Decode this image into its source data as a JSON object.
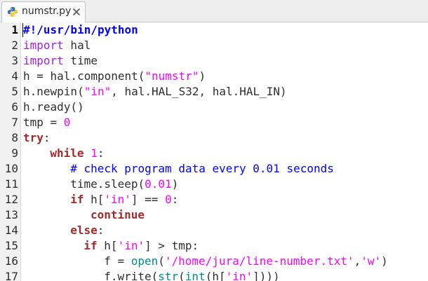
{
  "tab": {
    "filename": "numstr.py",
    "icon": "python-file-icon",
    "close_icon": "close-icon"
  },
  "colors": {
    "keyword": "#a52a2a",
    "import": "#a020f0",
    "string": "#ff00ff",
    "number": "#ff00ff",
    "comment": "#0000ff",
    "builtin": "#008b8b",
    "shebang": "#0000ff",
    "default": "#2e2e2e"
  },
  "editor": {
    "current_line": 1,
    "lines": [
      {
        "number": "1",
        "indent": 0,
        "tokens": [
          {
            "t": "shebang",
            "v": "#!/usr/bin/python"
          }
        ]
      },
      {
        "number": "2",
        "indent": 0,
        "tokens": [
          {
            "t": "import",
            "v": "import"
          },
          {
            "t": "default",
            "v": " hal"
          }
        ]
      },
      {
        "number": "3",
        "indent": 0,
        "tokens": [
          {
            "t": "import",
            "v": "import"
          },
          {
            "t": "default",
            "v": " time"
          }
        ]
      },
      {
        "number": "4",
        "indent": 0,
        "tokens": [
          {
            "t": "default",
            "v": "h = hal.component("
          },
          {
            "t": "string",
            "v": "\"numstr\""
          },
          {
            "t": "default",
            "v": ")"
          }
        ]
      },
      {
        "number": "5",
        "indent": 0,
        "tokens": [
          {
            "t": "default",
            "v": "h.newpin("
          },
          {
            "t": "string",
            "v": "\"in\""
          },
          {
            "t": "default",
            "v": ", hal.HAL_S32, hal.HAL_IN)"
          }
        ]
      },
      {
        "number": "6",
        "indent": 0,
        "tokens": [
          {
            "t": "default",
            "v": "h.ready()"
          }
        ]
      },
      {
        "number": "7",
        "indent": 0,
        "tokens": [
          {
            "t": "default",
            "v": "tmp = "
          },
          {
            "t": "number",
            "v": "0"
          }
        ]
      },
      {
        "number": "8",
        "indent": 0,
        "tokens": [
          {
            "t": "keyword",
            "v": "try"
          },
          {
            "t": "default",
            "v": ":"
          }
        ]
      },
      {
        "number": "9",
        "indent": 4,
        "tokens": [
          {
            "t": "keyword",
            "v": "while"
          },
          {
            "t": "default",
            "v": " "
          },
          {
            "t": "number",
            "v": "1"
          },
          {
            "t": "default",
            "v": ":"
          }
        ]
      },
      {
        "number": "10",
        "indent": 7,
        "tokens": [
          {
            "t": "comment",
            "v": "# check program data every 0.01 seconds"
          }
        ]
      },
      {
        "number": "11",
        "indent": 7,
        "tokens": [
          {
            "t": "default",
            "v": "time.sleep("
          },
          {
            "t": "number",
            "v": "0.01"
          },
          {
            "t": "default",
            "v": ")"
          }
        ]
      },
      {
        "number": "12",
        "indent": 7,
        "tokens": [
          {
            "t": "keyword",
            "v": "if"
          },
          {
            "t": "default",
            "v": " h["
          },
          {
            "t": "string",
            "v": "'in'"
          },
          {
            "t": "default",
            "v": "] == "
          },
          {
            "t": "number",
            "v": "0"
          },
          {
            "t": "default",
            "v": ":"
          }
        ]
      },
      {
        "number": "13",
        "indent": 10,
        "tokens": [
          {
            "t": "keyword",
            "v": "continue"
          }
        ]
      },
      {
        "number": "14",
        "indent": 7,
        "tokens": [
          {
            "t": "keyword",
            "v": "else"
          },
          {
            "t": "default",
            "v": ":"
          }
        ]
      },
      {
        "number": "15",
        "indent": 9,
        "tokens": [
          {
            "t": "keyword",
            "v": "if"
          },
          {
            "t": "default",
            "v": " h["
          },
          {
            "t": "string",
            "v": "'in'"
          },
          {
            "t": "default",
            "v": "] > tmp:"
          }
        ]
      },
      {
        "number": "16",
        "indent": 12,
        "tokens": [
          {
            "t": "default",
            "v": "f = "
          },
          {
            "t": "builtin",
            "v": "open"
          },
          {
            "t": "default",
            "v": "("
          },
          {
            "t": "string",
            "v": "'/home/jura/line-number.txt'"
          },
          {
            "t": "default",
            "v": ","
          },
          {
            "t": "string",
            "v": "'w'"
          },
          {
            "t": "default",
            "v": ")"
          }
        ]
      },
      {
        "number": "17",
        "indent": 12,
        "tokens": [
          {
            "t": "default",
            "v": "f.write("
          },
          {
            "t": "builtin",
            "v": "str"
          },
          {
            "t": "default",
            "v": "("
          },
          {
            "t": "builtin",
            "v": "int"
          },
          {
            "t": "default",
            "v": "(h["
          },
          {
            "t": "string",
            "v": "'in'"
          },
          {
            "t": "default",
            "v": "])))"
          }
        ]
      }
    ]
  }
}
